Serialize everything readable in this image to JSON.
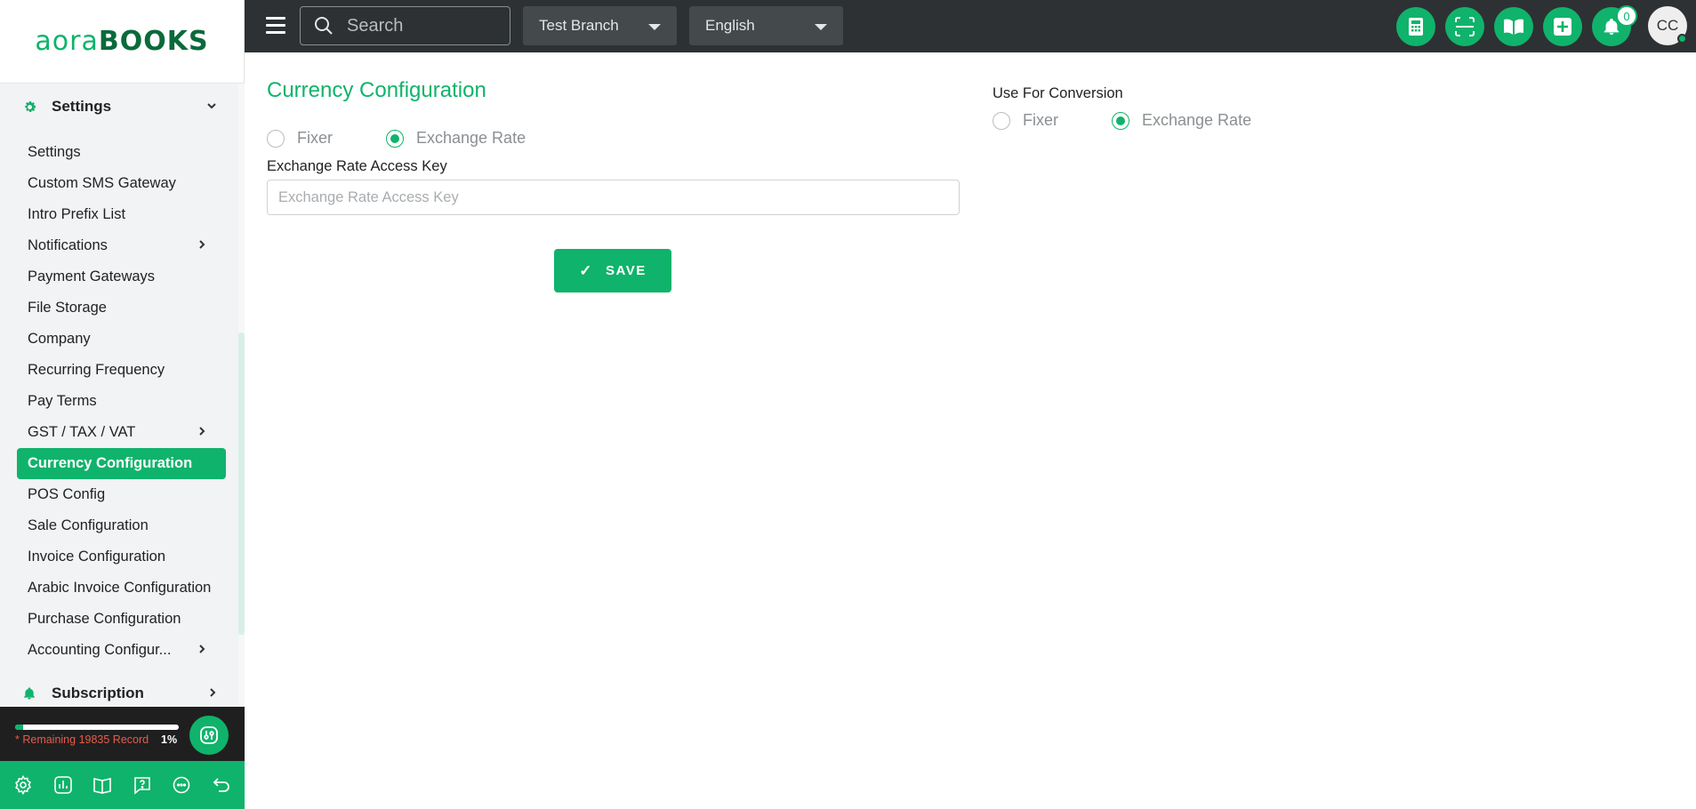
{
  "app": {
    "logo_part1": "aora",
    "logo_part2": "BOOKS"
  },
  "sidebar": {
    "settings_section": {
      "label": "Settings",
      "icon": "gear-icon"
    },
    "items": [
      {
        "label": "Settings"
      },
      {
        "label": "Custom SMS Gateway"
      },
      {
        "label": "Intro Prefix List"
      },
      {
        "label": "Notifications",
        "has_children": true
      },
      {
        "label": "Payment Gateways"
      },
      {
        "label": "File Storage"
      },
      {
        "label": "Company"
      },
      {
        "label": "Recurring Frequency"
      },
      {
        "label": "Pay Terms"
      },
      {
        "label": "GST / TAX / VAT",
        "has_children": true
      },
      {
        "label": "Currency Configuration",
        "active": true
      },
      {
        "label": "POS Config"
      },
      {
        "label": "Sale Configuration"
      },
      {
        "label": "Invoice Configuration"
      },
      {
        "label": "Arabic Invoice Configuration"
      },
      {
        "label": "Purchase Configuration"
      },
      {
        "label": "Accounting Configur...",
        "has_children": true
      }
    ],
    "subscription_section": {
      "label": "Subscription",
      "icon": "bell-icon"
    },
    "records": {
      "remaining_text": "* Remaining 19835 Record",
      "percent_text": "1%",
      "percent_value": 0.01
    },
    "bottom_icons": [
      "gear-icon",
      "chart-icon",
      "book-icon",
      "help-icon",
      "chat-icon",
      "undo-icon"
    ]
  },
  "topbar": {
    "search_placeholder": "Search",
    "branch": "Test Branch",
    "language": "English",
    "notification_count": "0",
    "avatar_initials": "CC",
    "tools": [
      "calculator-icon",
      "scan-icon",
      "book-open-icon",
      "plus-icon",
      "bell-icon"
    ]
  },
  "main": {
    "title": "Currency Configuration",
    "rate_options": [
      {
        "label": "Fixer",
        "selected": false
      },
      {
        "label": "Exchange Rate",
        "selected": true
      }
    ],
    "access_key_label": "Exchange Rate Access Key",
    "access_key_placeholder": "Exchange Rate Access Key",
    "access_key_value": "",
    "save_label": "SAVE",
    "conversion_label": "Use For Conversion",
    "conversion_options": [
      {
        "label": "Fixer",
        "selected": false
      },
      {
        "label": "Exchange Rate",
        "selected": true
      }
    ]
  },
  "colors": {
    "accent": "#10b36b",
    "topbar": "#2d3133",
    "sidebar_bg": "#f1f3f4"
  }
}
